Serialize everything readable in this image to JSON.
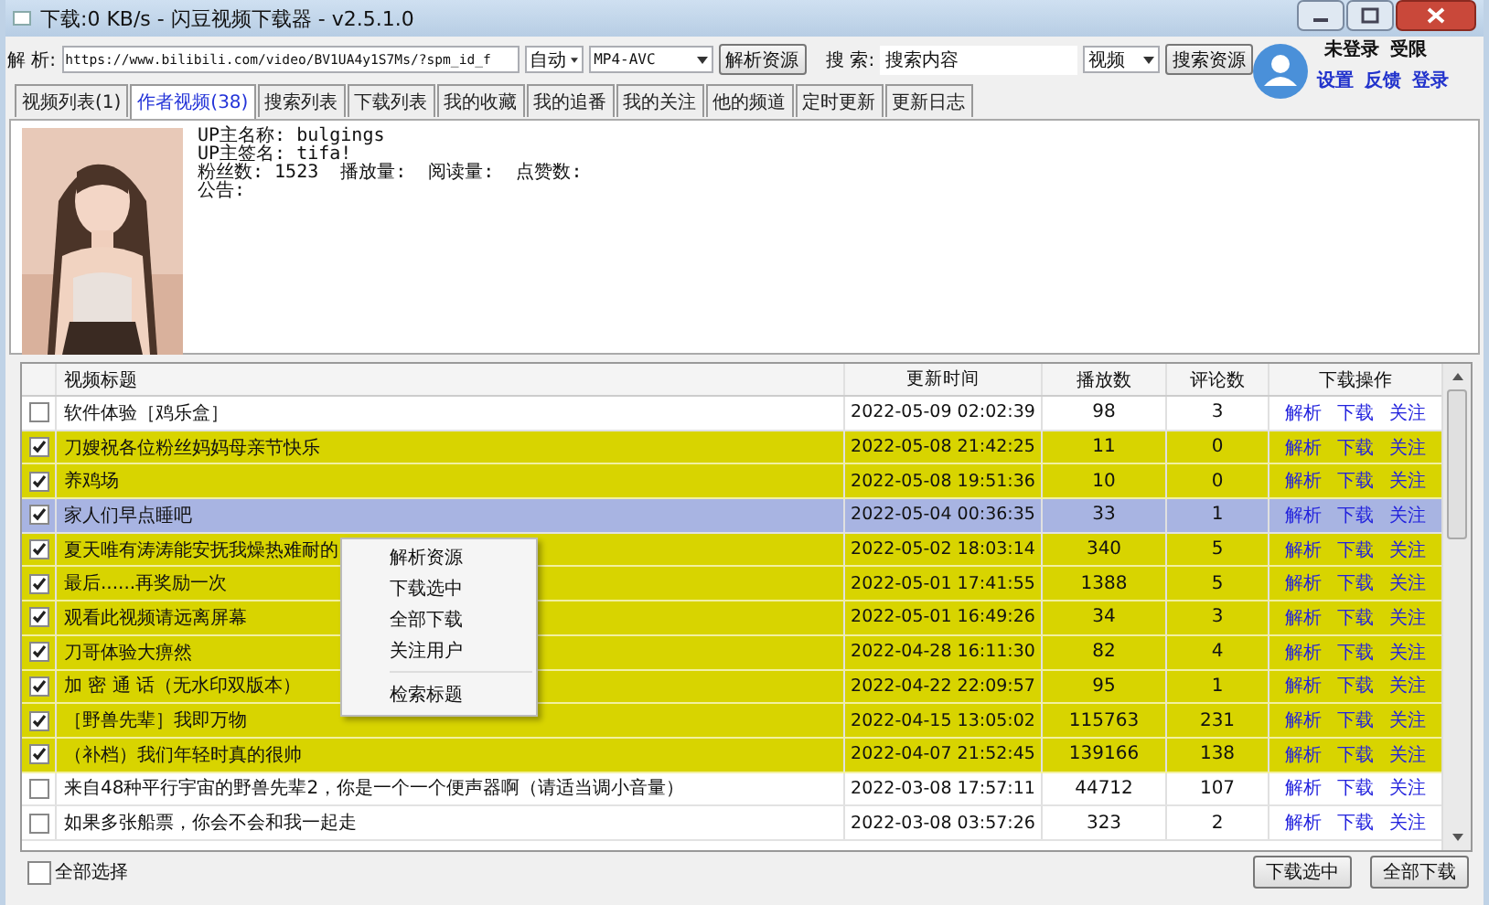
{
  "window": {
    "title": "下载:0 KB/s - 闪豆视频下载器 - v2.5.1.0"
  },
  "toolbar": {
    "parse_label": "解 析:",
    "url": "https://www.bilibili.com/video/BV1UA4y1S7Ms/?spm_id_f",
    "quality": "自动",
    "format": "MP4-AVC",
    "parse_button": "解析资源",
    "search_label": "搜 索:",
    "search_value": "搜索内容",
    "search_type": "视频",
    "search_button": "搜索资源"
  },
  "account": {
    "status": "未登录",
    "permission": "受限",
    "links": [
      "设置",
      "反馈",
      "登录"
    ]
  },
  "tabs": [
    {
      "label": "视频列表(1)",
      "selected": false
    },
    {
      "label": "作者视频(38)",
      "selected": true
    },
    {
      "label": "搜索列表",
      "selected": false
    },
    {
      "label": "下载列表",
      "selected": false
    },
    {
      "label": "我的收藏",
      "selected": false
    },
    {
      "label": "我的追番",
      "selected": false
    },
    {
      "label": "我的关注",
      "selected": false
    },
    {
      "label": "他的频道",
      "selected": false
    },
    {
      "label": "定时更新",
      "selected": false
    },
    {
      "label": "更新日志",
      "selected": false
    }
  ],
  "profile": {
    "lines": [
      "UP主名称: bulgings",
      "UP主签名: tifa!"
    ],
    "stats": [
      "粉丝数: 1523",
      "播放量:",
      "阅读量:",
      "点赞数:"
    ],
    "notice": "公告:"
  },
  "table": {
    "columns": [
      "视频标题",
      "更新时间",
      "播放数",
      "评论数",
      "下载操作"
    ],
    "rows": [
      {
        "title": "软件体验［鸡乐盒］",
        "time": "2022-05-09 02:02:39",
        "plays": "98",
        "comments": "3",
        "actions": [
          "解析",
          "下载",
          "关注"
        ],
        "checked": false,
        "selected": false
      },
      {
        "title": "刀嫂祝各位粉丝妈妈母亲节快乐",
        "time": "2022-05-08 21:42:25",
        "plays": "11",
        "comments": "0",
        "actions": [
          "解析",
          "下载",
          "关注"
        ],
        "checked": true,
        "selected": false
      },
      {
        "title": "养鸡场",
        "time": "2022-05-08 19:51:36",
        "plays": "10",
        "comments": "0",
        "actions": [
          "解析",
          "下载",
          "关注"
        ],
        "checked": true,
        "selected": false
      },
      {
        "title": "家人们早点睡吧",
        "time": "2022-05-04 00:36:35",
        "plays": "33",
        "comments": "1",
        "actions": [
          "解析",
          "下载",
          "关注"
        ],
        "checked": true,
        "selected": true
      },
      {
        "title": "夏天唯有涛涛能安抚我燥热难耐的",
        "time": "2022-05-02 18:03:14",
        "plays": "340",
        "comments": "5",
        "actions": [
          "解析",
          "下载",
          "关注"
        ],
        "checked": true,
        "selected": false
      },
      {
        "title": "最后......再奖励一次",
        "time": "2022-05-01 17:41:55",
        "plays": "1388",
        "comments": "5",
        "actions": [
          "解析",
          "下载",
          "关注"
        ],
        "checked": true,
        "selected": false
      },
      {
        "title": "观看此视频请远离屏幕",
        "time": "2022-05-01 16:49:26",
        "plays": "34",
        "comments": "3",
        "actions": [
          "解析",
          "下载",
          "关注"
        ],
        "checked": true,
        "selected": false
      },
      {
        "title": "刀哥体验大痹然",
        "time": "2022-04-28 16:11:30",
        "plays": "82",
        "comments": "4",
        "actions": [
          "解析",
          "下载",
          "关注"
        ],
        "checked": true,
        "selected": false
      },
      {
        "title": "加 密 通 话（无水印双版本）",
        "time": "2022-04-22 22:09:57",
        "plays": "95",
        "comments": "1",
        "actions": [
          "解析",
          "下载",
          "关注"
        ],
        "checked": true,
        "selected": false
      },
      {
        "title": "［野兽先辈］我即万物",
        "time": "2022-04-15 13:05:02",
        "plays": "115763",
        "comments": "231",
        "actions": [
          "解析",
          "下载",
          "关注"
        ],
        "checked": true,
        "selected": false
      },
      {
        "title": "（补档）我们年轻时真的很帅",
        "time": "2022-04-07 21:52:45",
        "plays": "139166",
        "comments": "138",
        "actions": [
          "解析",
          "下载",
          "关注"
        ],
        "checked": true,
        "selected": false
      },
      {
        "title": "来自48种平行宇宙的野兽先辈2，你是一个一个便声器啊（请适当调小音量）",
        "time": "2022-03-08 17:57:11",
        "plays": "44712",
        "comments": "107",
        "actions": [
          "解析",
          "下载",
          "关注"
        ],
        "checked": false,
        "selected": false
      },
      {
        "title": "如果多张船票，你会不会和我一起走",
        "time": "2022-03-08 03:57:26",
        "plays": "323",
        "comments": "2",
        "actions": [
          "解析",
          "下载",
          "关注"
        ],
        "checked": false,
        "selected": false
      }
    ]
  },
  "context_menu": {
    "items": [
      {
        "kind": "item",
        "label": "解析资源"
      },
      {
        "kind": "item",
        "label": "下载选中"
      },
      {
        "kind": "item",
        "label": "全部下载"
      },
      {
        "kind": "item",
        "label": "关注用户"
      },
      {
        "kind": "separator"
      },
      {
        "kind": "item",
        "label": "检索标题"
      }
    ]
  },
  "footer": {
    "select_all": {
      "label": "全部选择",
      "checked": false
    },
    "buttons": [
      "下载选中",
      "全部下载"
    ]
  }
}
